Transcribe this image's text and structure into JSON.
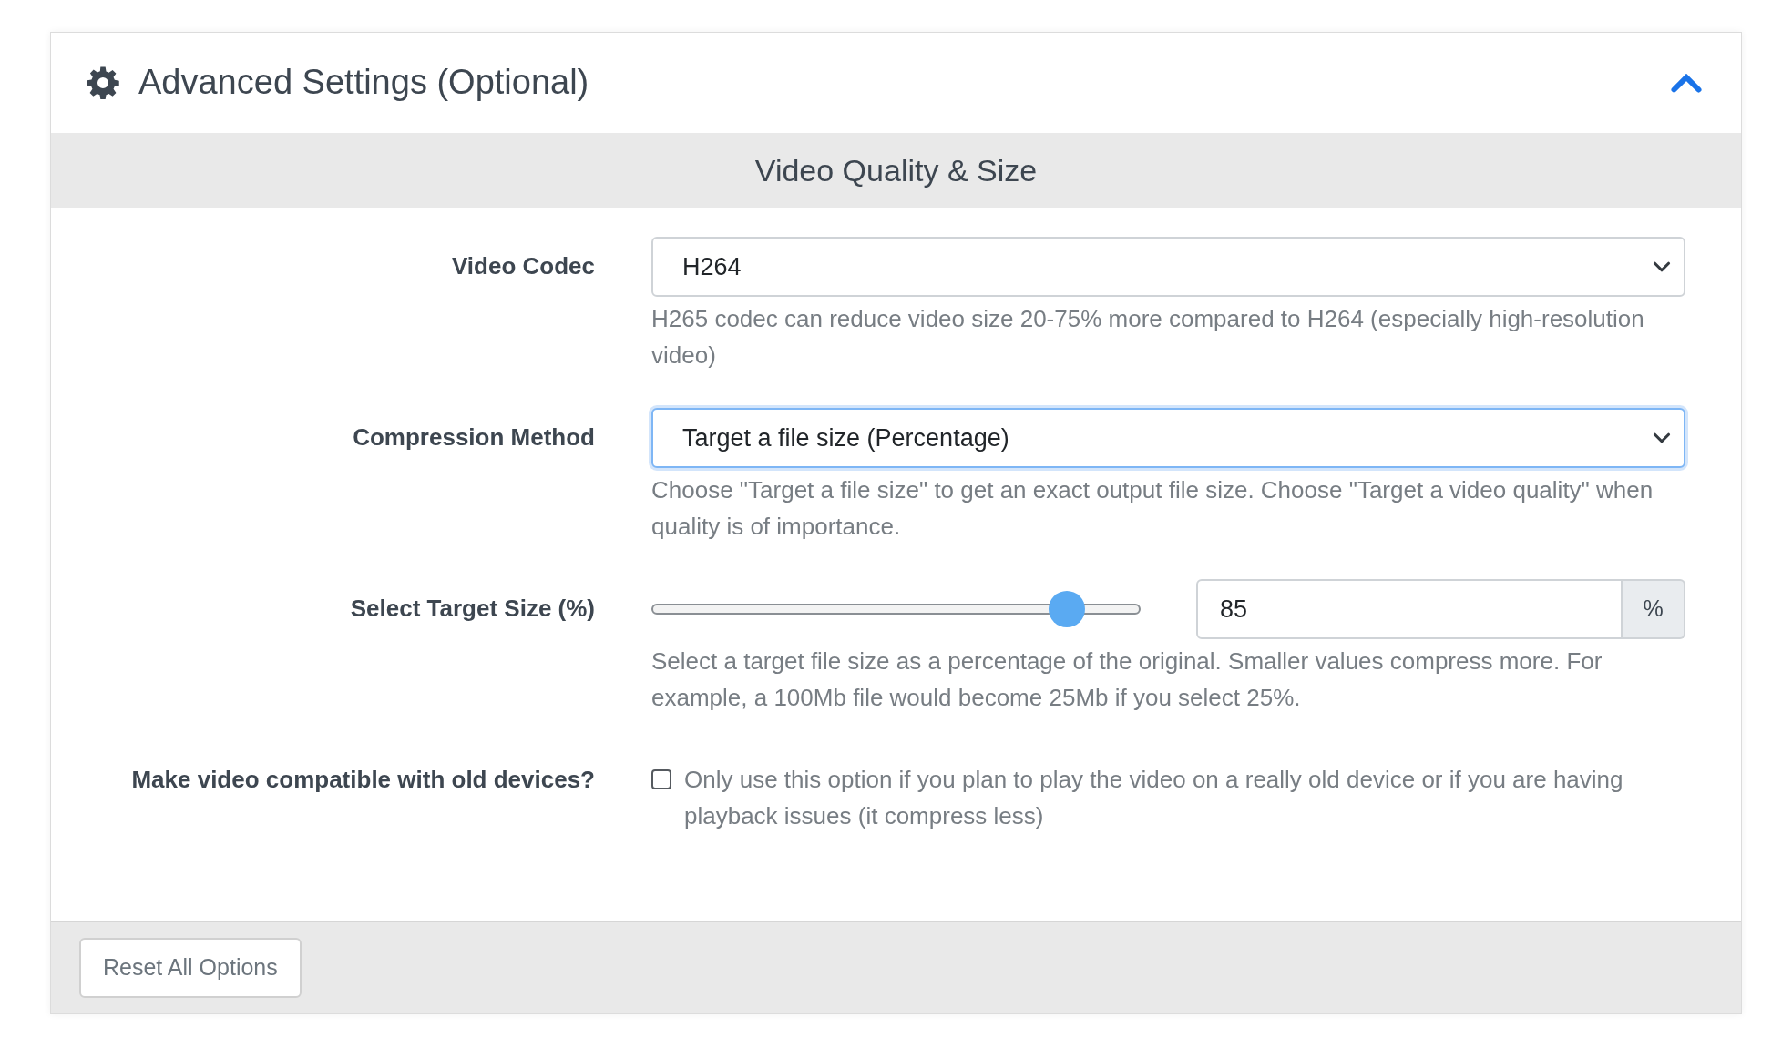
{
  "panel": {
    "title": "Advanced Settings (Optional)",
    "expanded": true
  },
  "section": {
    "title": "Video Quality & Size"
  },
  "fields": [
    {
      "kind": "select",
      "label": "Video Codec",
      "value": "H264",
      "focused": false,
      "help": "H265 codec can reduce video size 20-75% more compared to H264 (especially high-resolution video)"
    },
    {
      "kind": "select",
      "label": "Compression Method",
      "value": "Target a file size (Percentage)",
      "focused": true,
      "help": "Choose \"Target a file size\" to get an exact output file size. Choose \"Target a video quality\" when quality is of importance."
    },
    {
      "kind": "slider",
      "label": "Select Target Size (%)",
      "level": 0.85,
      "value": "85",
      "unit": "%",
      "help": "Select a target file size as a percentage of the original. Smaller values compress more. For example, a 100Mb file would become 25Mb if you select 25%."
    },
    {
      "kind": "checkbox",
      "label": "Make video compatible with old devices?",
      "checked": false,
      "help": "Only use this option if you plan to play the video on a really old device or if you are having playback issues (it compress less)"
    }
  ],
  "footer": {
    "button": "Reset All Options"
  }
}
